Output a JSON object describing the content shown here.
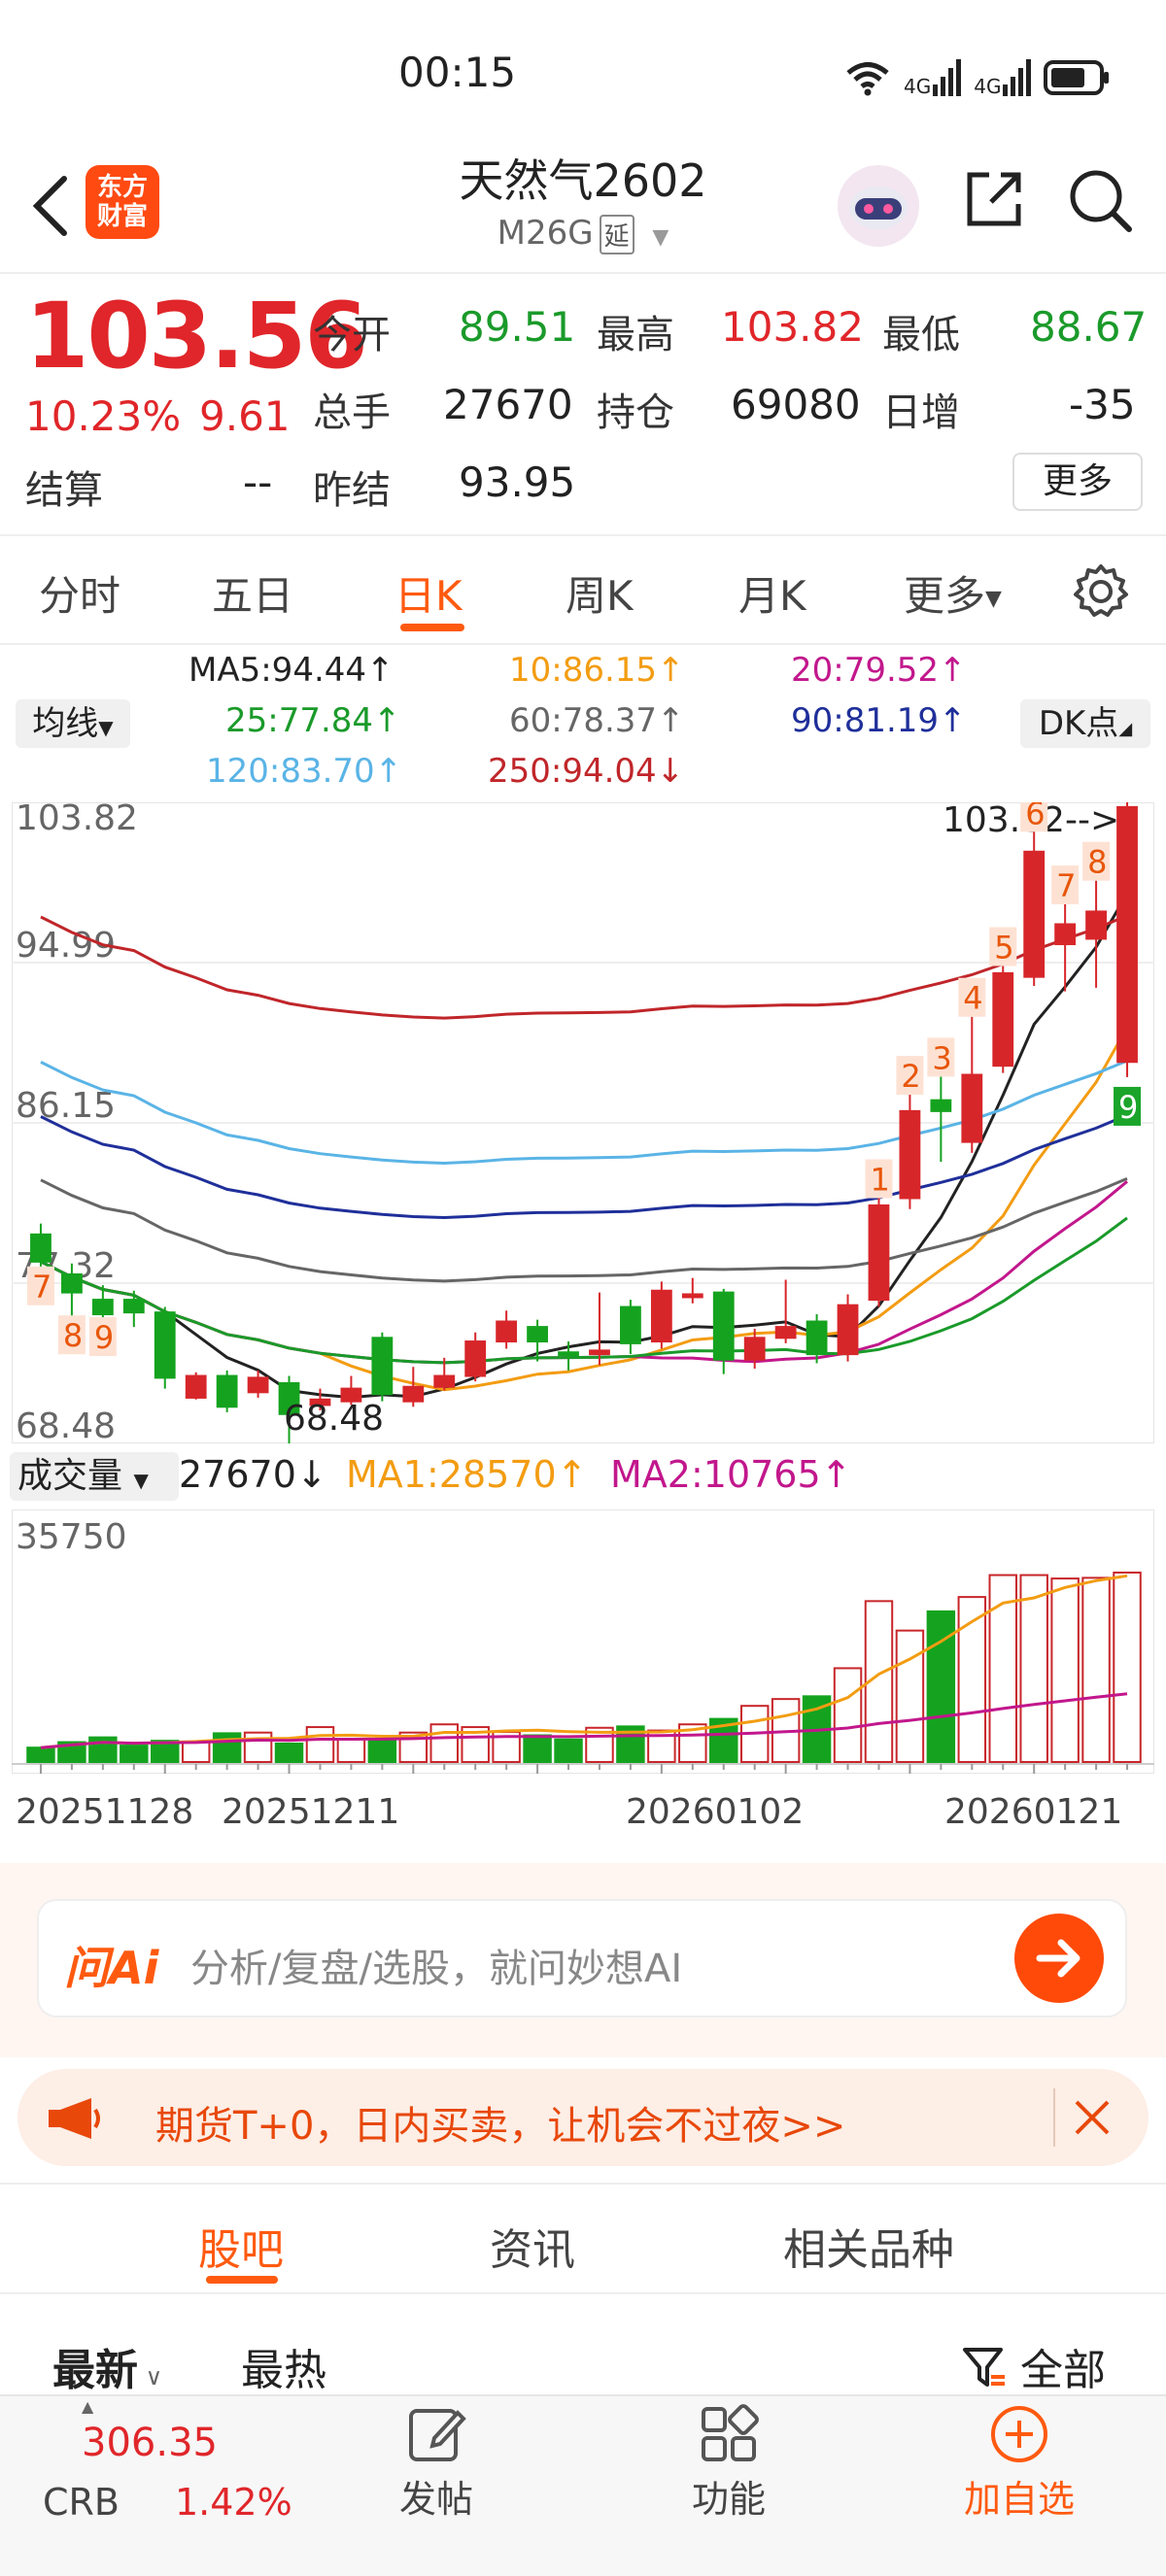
{
  "status_bar": {
    "time": "00:15",
    "network_1": "4G",
    "network_2": "4G"
  },
  "header": {
    "logo_line1": "东方",
    "logo_line2": "财富",
    "title": "天然气2602",
    "subtitle": "M26G",
    "subtitle_badge": "延"
  },
  "quote": {
    "price": "103.56",
    "change_pct": "10.23%",
    "change": "9.61",
    "fields": {
      "open_label": "今开",
      "open": "89.51",
      "high_label": "最高",
      "high": "103.82",
      "low_label": "最低",
      "low": "88.67",
      "volume_label": "总手",
      "volume": "27670",
      "oi_label": "持仓",
      "oi": "69080",
      "daily_inc_label": "日增",
      "daily_inc": "-35",
      "settle_label": "结算",
      "settle": "--",
      "prev_settle_label": "昨结",
      "prev_settle": "93.95"
    },
    "more_button": "更多"
  },
  "chart_tabs": [
    "分时",
    "五日",
    "日K",
    "周K",
    "月K",
    "更多"
  ],
  "chart_tabs_active": 2,
  "ma_controls": {
    "type_label": "均线",
    "dk_label": "DK点",
    "legend": [
      {
        "text": "MA5:94.44↑",
        "color": "#222222"
      },
      {
        "text": "10:86.15↑",
        "color": "#f39c12"
      },
      {
        "text": "20:79.52↑",
        "color": "#c2178c"
      },
      {
        "text": "25:77.84↑",
        "color": "#1a9a2a"
      },
      {
        "text": "60:78.37↑",
        "color": "#666666"
      },
      {
        "text": "90:81.19↑",
        "color": "#1f2f9a"
      },
      {
        "text": "120:83.70↑",
        "color": "#5ab4e6"
      },
      {
        "text": "250:94.04↓",
        "color": "#c0262a"
      }
    ]
  },
  "chart_data": [
    {
      "type": "candlestick",
      "y_tick_labels": [
        "103.82",
        "94.99",
        "86.15",
        "77.32",
        "68.48"
      ],
      "ylim": [
        68.48,
        103.82
      ],
      "annotations": {
        "high_marker": "103.82-->",
        "low_marker": "68.48"
      },
      "td_counts": [
        "7",
        "8",
        "9",
        "1",
        "2",
        "3",
        "4",
        "5",
        "6",
        "7",
        "8",
        "9"
      ],
      "candles": [
        {
          "o": 80.0,
          "c": 78.5,
          "h": 80.6,
          "l": 77.7
        },
        {
          "o": 77.8,
          "c": 76.8,
          "h": 78.4,
          "l": 75.0
        },
        {
          "o": 76.4,
          "c": 75.6,
          "h": 77.2,
          "l": 74.9
        },
        {
          "o": 76.4,
          "c": 75.7,
          "h": 76.9,
          "l": 74.9
        },
        {
          "o": 75.7,
          "c": 72.1,
          "h": 76.0,
          "l": 71.5
        },
        {
          "o": 71.0,
          "c": 72.2,
          "h": 72.4,
          "l": 70.9
        },
        {
          "o": 72.2,
          "c": 70.5,
          "h": 72.5,
          "l": 70.2
        },
        {
          "o": 71.3,
          "c": 72.1,
          "h": 72.5,
          "l": 71.0
        },
        {
          "o": 71.8,
          "c": 70.1,
          "h": 72.2,
          "l": 68.48
        },
        {
          "o": 70.6,
          "c": 70.9,
          "h": 71.5,
          "l": 70.3
        },
        {
          "o": 70.8,
          "c": 71.5,
          "h": 72.2,
          "l": 70.6
        },
        {
          "o": 74.3,
          "c": 71.2,
          "h": 74.6,
          "l": 70.8
        },
        {
          "o": 70.8,
          "c": 71.6,
          "h": 72.7,
          "l": 70.5
        },
        {
          "o": 71.6,
          "c": 72.2,
          "h": 73.2,
          "l": 71.4
        },
        {
          "o": 72.2,
          "c": 74.1,
          "h": 74.6,
          "l": 71.9
        },
        {
          "o": 74.1,
          "c": 75.2,
          "h": 75.8,
          "l": 73.7
        },
        {
          "o": 74.9,
          "c": 74.1,
          "h": 75.3,
          "l": 73.0
        },
        {
          "o": 73.5,
          "c": 73.4,
          "h": 74.1,
          "l": 72.5
        },
        {
          "o": 73.4,
          "c": 73.6,
          "h": 76.8,
          "l": 72.8
        },
        {
          "o": 76.0,
          "c": 74.0,
          "h": 76.4,
          "l": 73.4
        },
        {
          "o": 74.1,
          "c": 76.9,
          "h": 77.4,
          "l": 73.7
        },
        {
          "o": 76.6,
          "c": 76.7,
          "h": 77.6,
          "l": 76.2
        },
        {
          "o": 76.8,
          "c": 73.1,
          "h": 77.0,
          "l": 72.3
        },
        {
          "o": 73.1,
          "c": 74.3,
          "h": 74.8,
          "l": 72.6
        },
        {
          "o": 74.3,
          "c": 74.9,
          "h": 77.5,
          "l": 74.0
        },
        {
          "o": 75.2,
          "c": 73.4,
          "h": 75.6,
          "l": 72.9
        },
        {
          "o": 73.4,
          "c": 76.1,
          "h": 76.7,
          "l": 73.0
        },
        {
          "o": 76.4,
          "c": 81.6,
          "h": 82.0,
          "l": 76.0
        },
        {
          "o": 82.0,
          "c": 86.8,
          "h": 87.7,
          "l": 81.4
        },
        {
          "o": 87.4,
          "c": 86.8,
          "h": 88.7,
          "l": 84.0
        },
        {
          "o": 85.1,
          "c": 88.8,
          "h": 92.0,
          "l": 84.5
        },
        {
          "o": 89.3,
          "c": 94.4,
          "h": 94.8,
          "l": 88.9
        },
        {
          "o": 94.2,
          "c": 101.1,
          "h": 102.2,
          "l": 93.7
        },
        {
          "o": 96.0,
          "c": 97.1,
          "h": 98.2,
          "l": 93.4
        },
        {
          "o": 96.3,
          "c": 97.8,
          "h": 99.5,
          "l": 93.6
        },
        {
          "o": 89.51,
          "c": 103.56,
          "h": 103.82,
          "l": 88.67
        }
      ]
    },
    {
      "type": "bar",
      "title": "成交量",
      "ylim": [
        0,
        35750
      ],
      "y_tick_labels": [
        "35750"
      ],
      "x_tick_labels": [
        "20251128",
        "20251211",
        "20260102",
        "20260121"
      ],
      "legend": [
        {
          "text": "27670↓",
          "color": "#222222"
        },
        {
          "text": "MA1:28570↑",
          "color": "#f39c12"
        },
        {
          "text": "MA2:10765↑",
          "color": "#c2178c"
        }
      ],
      "values": [
        2100,
        2900,
        3600,
        2400,
        3100,
        3000,
        4200,
        4300,
        2700,
        5100,
        3300,
        3400,
        4300,
        5500,
        5100,
        4400,
        3900,
        3300,
        5000,
        5200,
        4600,
        5500,
        6300,
        8200,
        9200,
        9600,
        13700,
        23500,
        19200,
        22000,
        24100,
        27300,
        27300,
        26800,
        26900,
        27670
      ]
    }
  ],
  "ai_search": {
    "logo": "问Ai",
    "placeholder": "分析/复盘/选股，就问妙想AI"
  },
  "promo": {
    "text": "期货T+0，日内买卖，让机会不过夜>>"
  },
  "bottom_tabs": [
    "股吧",
    "资讯",
    "相关品种"
  ],
  "bottom_tabs_active": 0,
  "sort": {
    "latest": "最新",
    "hot": "最热",
    "filter": "全部"
  },
  "bottom_nav": {
    "ticker_price": "306.35",
    "ticker_name": "CRB",
    "ticker_pct": "1.42%",
    "post": "发帖",
    "functions": "功能",
    "add": "加自选"
  }
}
